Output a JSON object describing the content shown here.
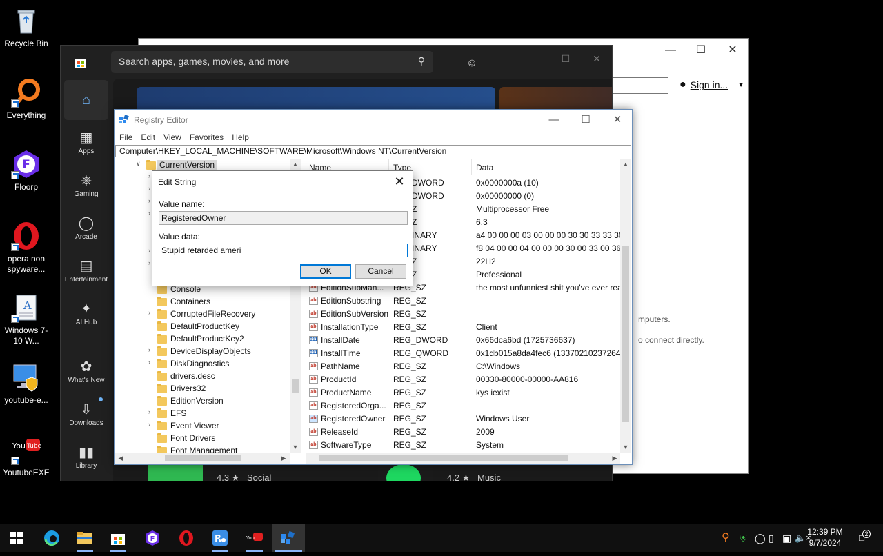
{
  "desktop": {
    "icons": [
      {
        "label": "Recycle Bin"
      },
      {
        "label": "Everything"
      },
      {
        "label": "Floorp"
      },
      {
        "label": "opera non spyware..."
      },
      {
        "label": "Windows 7-10 W..."
      },
      {
        "label": "youtube-e..."
      },
      {
        "label": "YoutubeEXE"
      }
    ]
  },
  "bg_window": {
    "signin_label": "Sign in...",
    "text1": "mputers.",
    "text2": "o connect directly."
  },
  "store": {
    "search_placeholder": "Search apps, games, movies, and more",
    "nav": [
      {
        "label": ""
      },
      {
        "label": "Apps"
      },
      {
        "label": "Gaming"
      },
      {
        "label": "Arcade"
      },
      {
        "label": "Entertainment"
      },
      {
        "label": "AI Hub"
      },
      {
        "label": "What's New"
      },
      {
        "label": "Downloads"
      },
      {
        "label": "Library"
      }
    ],
    "tiles": [
      {
        "rating": "4.3 ★",
        "category": "Social"
      },
      {
        "rating": "4.2 ★",
        "category": "Music"
      }
    ]
  },
  "regedit": {
    "title": "Registry Editor",
    "menu": [
      "File",
      "Edit",
      "View",
      "Favorites",
      "Help"
    ],
    "address": "Computer\\HKEY_LOCAL_MACHINE\\SOFTWARE\\Microsoft\\Windows NT\\CurrentVersion",
    "tree_top": "CurrentVersion",
    "tree": [
      "Console",
      "Containers",
      "CorruptedFileRecovery",
      "DefaultProductKey",
      "DefaultProductKey2",
      "DeviceDisplayObjects",
      "DiskDiagnostics",
      "drivers.desc",
      "Drivers32",
      "EditionVersion",
      "EFS",
      "Event Viewer",
      "Font Drivers",
      "Font Management"
    ],
    "columns": {
      "name": "Name",
      "type": "Type",
      "data": "Data"
    },
    "partial_rows": [
      {
        "type": "DWORD",
        "data": "0x0000000a (10)"
      },
      {
        "type": "DWORD",
        "data": "0x00000000 (0)"
      },
      {
        "type": "Z",
        "data": "Multiprocessor Free"
      },
      {
        "type": "Z",
        "data": "6.3"
      },
      {
        "type": "INARY",
        "data": "a4 00 00 00 03 00 00 00 30 30 33 33 30 2d"
      },
      {
        "type": "INARY",
        "data": "f8 04 00 00 04 00 00 00 30 00 33 00 36 00"
      },
      {
        "type": "Z",
        "data": "22H2"
      },
      {
        "type": "Z",
        "data": "Professional"
      }
    ],
    "rows": [
      {
        "name": "EditionSubMan...",
        "type": "REG_SZ",
        "data": "the most unfunniest shit you've ever rea"
      },
      {
        "name": "EditionSubstring",
        "type": "REG_SZ",
        "data": ""
      },
      {
        "name": "EditionSubVersion",
        "type": "REG_SZ",
        "data": ""
      },
      {
        "name": "InstallationType",
        "type": "REG_SZ",
        "data": "Client"
      },
      {
        "name": "InstallDate",
        "type": "REG_DWORD",
        "data": "0x66dca6bd (1725736637)"
      },
      {
        "name": "InstallTime",
        "type": "REG_QWORD",
        "data": "0x1db015a8da4fec6 (13370210237264659"
      },
      {
        "name": "PathName",
        "type": "REG_SZ",
        "data": "C:\\Windows"
      },
      {
        "name": "ProductId",
        "type": "REG_SZ",
        "data": "00330-80000-00000-AA816"
      },
      {
        "name": "ProductName",
        "type": "REG_SZ",
        "data": "kys iexist"
      },
      {
        "name": "RegisteredOrga...",
        "type": "REG_SZ",
        "data": ""
      },
      {
        "name": "RegisteredOwner",
        "type": "REG_SZ",
        "data": "Windows User"
      },
      {
        "name": "ReleaseId",
        "type": "REG_SZ",
        "data": "2009"
      },
      {
        "name": "SoftwareType",
        "type": "REG_SZ",
        "data": "System"
      }
    ]
  },
  "dialog": {
    "title": "Edit String",
    "value_name_label": "Value name:",
    "value_name": "RegisteredOwner",
    "value_data_label": "Value data:",
    "value_data": "Stupid retarded ameri",
    "ok_label": "OK",
    "cancel_label": "Cancel"
  },
  "taskbar": {
    "time": "12:39 PM",
    "date": "9/7/2024",
    "notification_count": "2"
  },
  "colors": {
    "accent": "#0078d7",
    "store_bg": "#202020",
    "folder": "#f3c85d"
  }
}
